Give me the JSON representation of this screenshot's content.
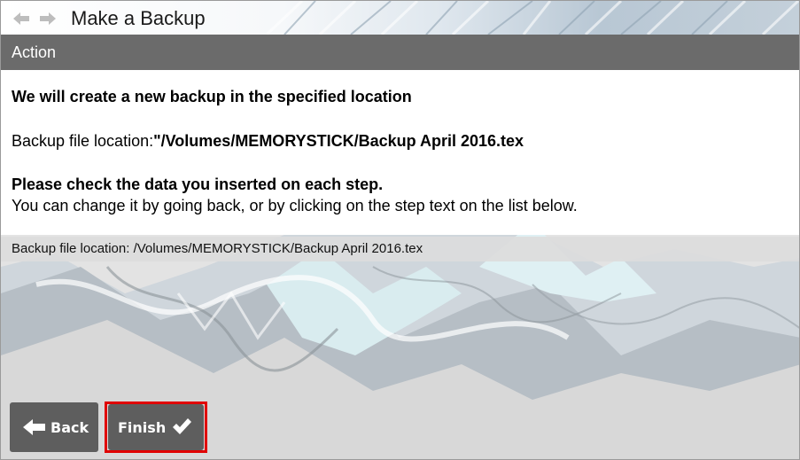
{
  "titlebar": {
    "title": "Make a Backup",
    "back_icon": "arrow-left-icon",
    "forward_icon": "arrow-right-icon"
  },
  "section": {
    "title": "Action"
  },
  "content": {
    "heading": "We will create a new backup in the specified location",
    "location_label": "Backup file location:",
    "location_value": "\"/Volumes/MEMORYSTICK/Backup April 2016.tex",
    "check_heading": "Please check the data you inserted on each step.",
    "check_subtext": "You can change it by going back, or by clicking on the step text on the list below."
  },
  "steps": [
    {
      "label": "Backup file location: /Volumes/MEMORYSTICK/Backup April 2016.tex"
    }
  ],
  "buttons": {
    "back_label": "Back",
    "back_icon": "arrow-left-icon",
    "finish_label": "Finish",
    "finish_icon": "checkmark-icon"
  },
  "colors": {
    "header_bg": "#6b6b6b",
    "button_bg": "#5e5e5e",
    "highlight_outline": "#e00000"
  }
}
